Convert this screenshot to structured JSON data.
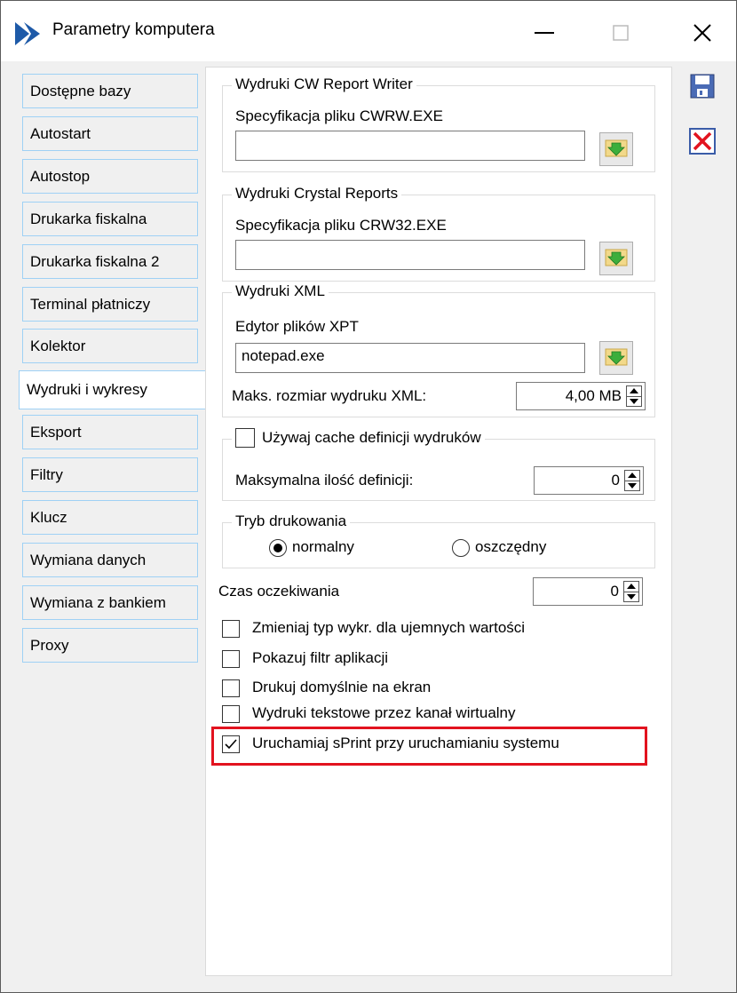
{
  "window": {
    "title": "Parametry komputera",
    "accent_color": "#e2131f",
    "logo_color": "#1e5aa8"
  },
  "tabs": [
    {
      "label": "Dostępne bazy",
      "active": false
    },
    {
      "label": "Autostart",
      "active": false
    },
    {
      "label": "Autostop",
      "active": false
    },
    {
      "label": "Drukarka fiskalna",
      "active": false
    },
    {
      "label": "Drukarka fiskalna 2",
      "active": false
    },
    {
      "label": "Terminal płatniczy",
      "active": false
    },
    {
      "label": "Kolektor",
      "active": false
    },
    {
      "label": "Wydruki i wykresy",
      "active": true
    },
    {
      "label": "Eksport",
      "active": false
    },
    {
      "label": "Filtry",
      "active": false
    },
    {
      "label": "Klucz",
      "active": false
    },
    {
      "label": "Wymiana danych",
      "active": false
    },
    {
      "label": "Wymiana z bankiem",
      "active": false
    },
    {
      "label": "Proxy",
      "active": false
    }
  ],
  "cwrw": {
    "legend": "Wydruki CW Report Writer",
    "label": "Specyfikacja pliku CWRW.EXE",
    "value": ""
  },
  "crystal": {
    "legend": "Wydruki Crystal Reports",
    "label": "Specyfikacja pliku CRW32.EXE",
    "value": ""
  },
  "xml": {
    "legend": "Wydruki XML",
    "label": "Edytor plików XPT",
    "value": "notepad.exe",
    "max_label": "Maks. rozmiar wydruku XML:",
    "max_value": "4,00 MB"
  },
  "cache": {
    "legend": "Używaj cache definicji wydruków",
    "checked": false,
    "max_label": "Maksymalna ilość definicji:",
    "max_value": "0"
  },
  "print_mode": {
    "legend": "Tryb drukowania",
    "options": [
      {
        "label": "normalny",
        "selected": true
      },
      {
        "label": "oszczędny",
        "selected": false
      }
    ]
  },
  "wait": {
    "label": "Czas oczekiwania",
    "value": "0"
  },
  "checkboxes": [
    {
      "label": "Zmieniaj typ wykr. dla ujemnych wartości",
      "checked": false
    },
    {
      "label": "Pokazuj filtr aplikacji",
      "checked": false
    },
    {
      "label": "Drukuj domyślnie na ekran",
      "checked": false
    },
    {
      "label": "Wydruki tekstowe przez kanał wirtualny",
      "checked": false
    },
    {
      "label": "Uruchamiaj sPrint przy uruchamianiu systemu",
      "checked": true
    }
  ],
  "icons": {
    "logo": "app-logo-icon",
    "minimize": "minimize-icon",
    "maximize": "maximize-icon",
    "close": "close-icon",
    "browse": "folder-arrow-icon",
    "save": "save-disk-icon",
    "cancel": "cancel-x-icon"
  }
}
